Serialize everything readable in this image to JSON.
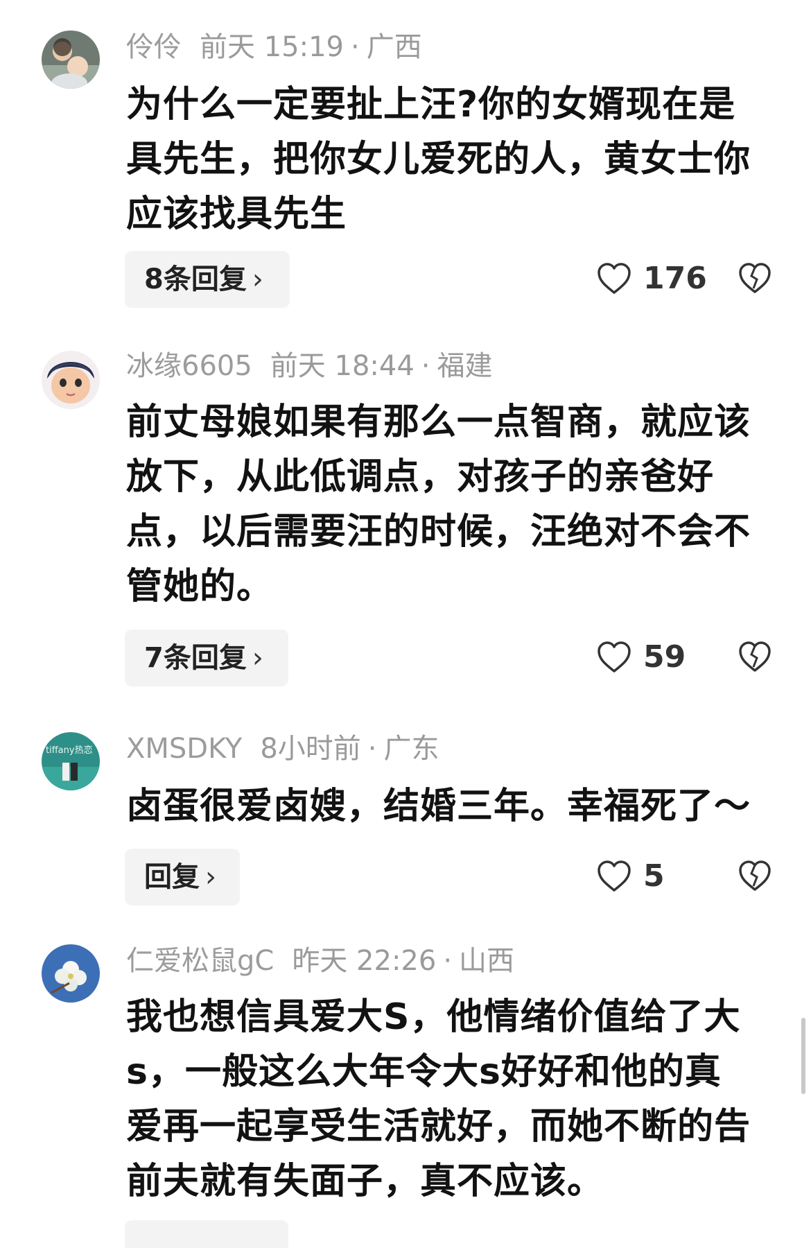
{
  "comments": [
    {
      "user": "伶伶",
      "time": "前天 15:19",
      "location": "广西",
      "lines": [
        "为什么一定要扯上汪?你的女婿现在是",
        "具先生，把你女儿爱死的人，黄女士你",
        "应该找具先生"
      ],
      "replies": "8条回复",
      "likes": "176"
    },
    {
      "user": "冰缘6605",
      "time": "前天 18:44",
      "location": "福建",
      "lines": [
        "前丈母娘如果有那么一点智商，就应该",
        "放下，从此低调点，对孩子的亲爸好",
        "点，以后需要汪的时候，汪绝对不会不",
        "管她的。"
      ],
      "replies": "7条回复",
      "likes": "59"
    },
    {
      "user": "XMSDKY",
      "time": "8小时前",
      "location": "广东",
      "lines": [
        "卤蛋很爱卤嫂，结婚三年。幸福死了～"
      ],
      "replies": "回复",
      "likes": "5"
    },
    {
      "user": "仁爱松鼠gC",
      "time": "昨天 22:26",
      "location": "山西",
      "lines": [
        "我也想信具爱大S，他情绪价值给了大",
        "s，一般这么大年令大s好好和他的真",
        "爱再一起享受生活就好，而她不断的告",
        "前夫就有失面子，真不应该。"
      ]
    }
  ],
  "icons": {
    "like": "heart-outline-icon",
    "dislike": "broken-heart-icon",
    "chevron": "chevron-right-icon"
  },
  "avatar_text": {
    "c3": "tiffany热恋"
  },
  "colors": {
    "meta": "#9a9a9a",
    "text": "#121212",
    "button_bg": "#f3f3f3"
  }
}
